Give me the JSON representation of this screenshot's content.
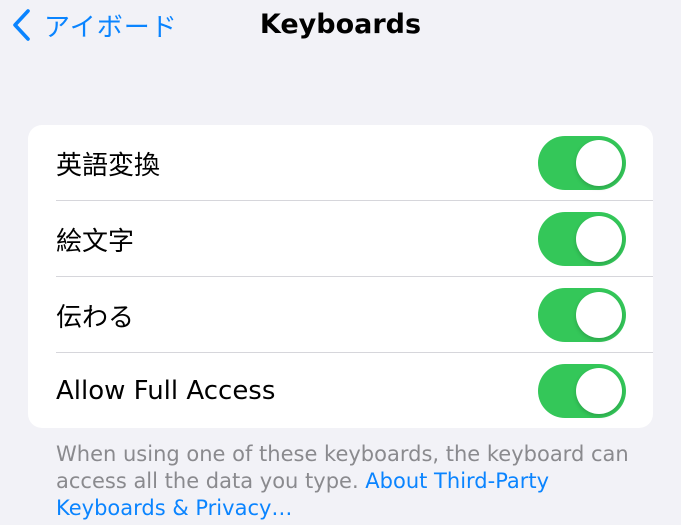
{
  "nav": {
    "back_label": "アイボード",
    "title": "Keyboards"
  },
  "settings": {
    "rows": [
      {
        "label": "英語変換",
        "toggle_on": true
      },
      {
        "label": "絵文字",
        "toggle_on": true
      },
      {
        "label": "伝わる",
        "toggle_on": true
      },
      {
        "label": "Allow Full Access",
        "toggle_on": true
      }
    ]
  },
  "footer": {
    "text": "When using one of these keyboards, the keyboard can access all the data you type. ",
    "link": "About Third-Party Keyboards & Privacy…"
  },
  "colors": {
    "accent": "#0a84ff",
    "toggle_on": "#34c759",
    "background": "#f2f2f7",
    "secondary_text": "#8a8a8e"
  }
}
